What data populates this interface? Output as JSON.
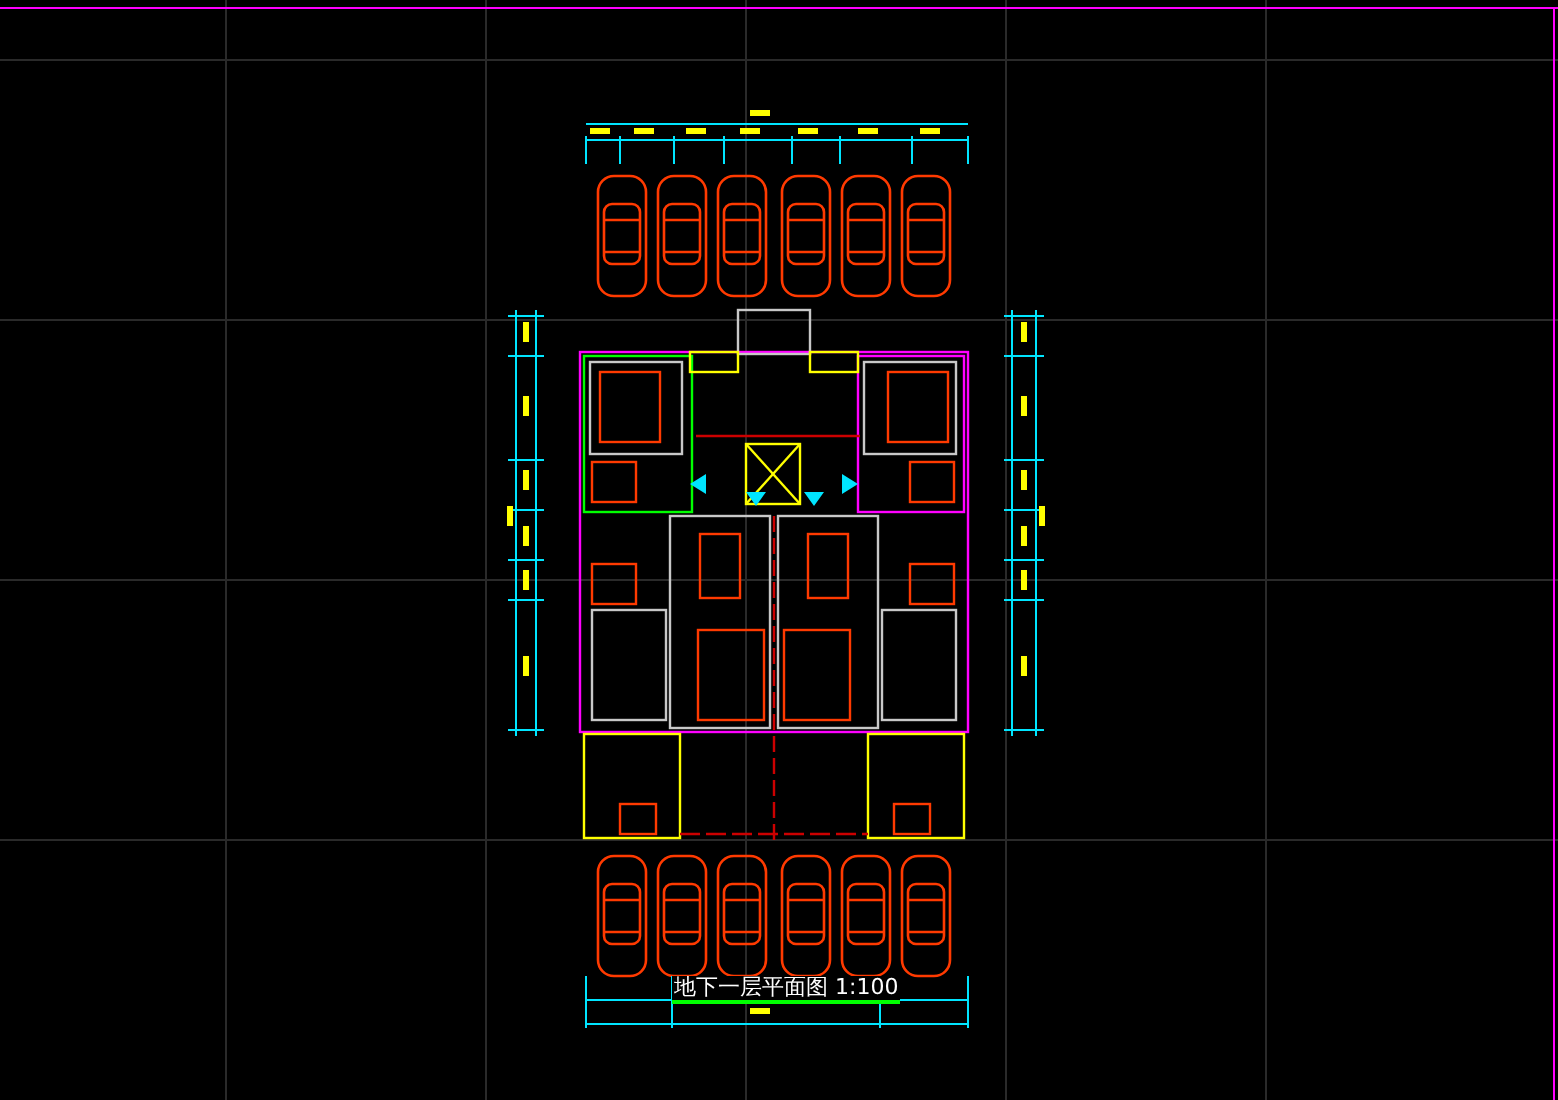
{
  "drawing": {
    "title": "地下一层平面图 1:100"
  }
}
